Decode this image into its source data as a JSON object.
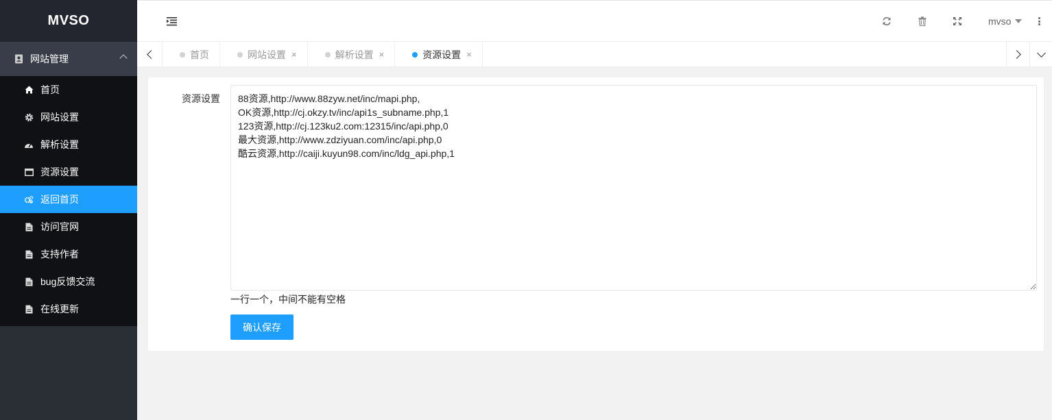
{
  "app": {
    "title": "MVSO"
  },
  "sidebar": {
    "group": {
      "label": "网站管理",
      "icon": "address-book-icon"
    },
    "items": [
      {
        "label": "首页",
        "icon": "home-icon"
      },
      {
        "label": "网站设置",
        "icon": "gear-icon"
      },
      {
        "label": "解析设置",
        "icon": "dashboard-icon"
      },
      {
        "label": "资源设置",
        "icon": "window-icon"
      },
      {
        "label": "返回首页",
        "icon": "gears-icon",
        "active": true
      },
      {
        "label": "访问官网",
        "icon": "file-icon"
      },
      {
        "label": "支持作者",
        "icon": "file-icon"
      },
      {
        "label": "bug反馈交流",
        "icon": "file-icon"
      },
      {
        "label": "在线更新",
        "icon": "file-icon"
      }
    ]
  },
  "header": {
    "icons": [
      "refresh-icon",
      "trash-icon",
      "fullscreen-icon"
    ],
    "user": "mvso"
  },
  "tabs": [
    {
      "label": "首页",
      "closable": false,
      "active": false
    },
    {
      "label": "网站设置",
      "closable": true,
      "active": false
    },
    {
      "label": "解析设置",
      "closable": true,
      "active": false
    },
    {
      "label": "资源设置",
      "closable": true,
      "active": true
    }
  ],
  "tab_close_glyph": "×",
  "form": {
    "label": "资源设置",
    "value": "88资源,http://www.88zyw.net/inc/mapi.php,\nOK资源,http://cj.okzy.tv/inc/api1s_subname.php,1\n123资源,http://cj.123ku2.com:12315/inc/api.php,0\n最大资源,http://www.zdziyuan.com/inc/api.php,0\n酷云资源,http://caiji.kuyun98.com/inc/ldg_api.php,1",
    "tip": "一行一个，中间不能有空格",
    "save_label": "确认保存"
  },
  "colors": {
    "accent": "#1e9fff",
    "sidebar_bg": "#2a2f36",
    "sidebar_sub_bg": "#0f1115"
  }
}
